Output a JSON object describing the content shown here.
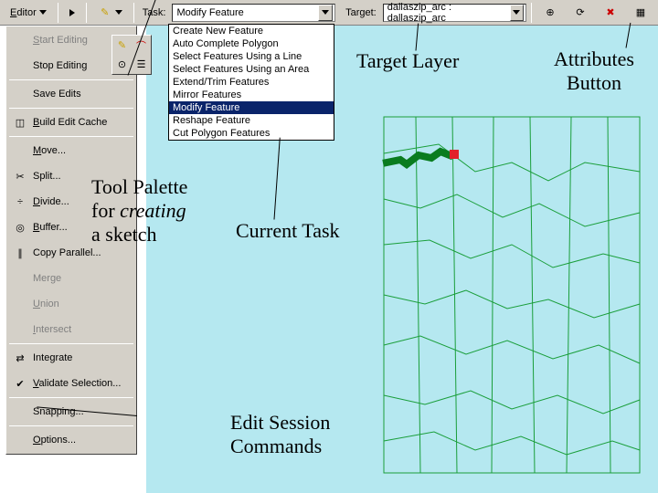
{
  "toolbar": {
    "editor_label": "Editor",
    "task_label": "Task:",
    "task_value": "Modify Feature",
    "target_label": "Target:",
    "target_value": "dallaszip_arc : dallaszip_arc"
  },
  "task_options": [
    "Create New Feature",
    "Auto Complete Polygon",
    "Select Features Using a Line",
    "Select Features Using an Area",
    "Extend/Trim Features",
    "Mirror Features",
    "Modify Feature",
    "Reshape Feature",
    "Cut Polygon Features"
  ],
  "task_selected_index": 6,
  "editor_menu": [
    {
      "label": "Start Editing",
      "disabled": true,
      "icon": "",
      "u": true
    },
    {
      "label": "Stop Editing",
      "disabled": false,
      "icon": "",
      "u": false
    },
    {
      "sep": true
    },
    {
      "label": "Save Edits",
      "disabled": false,
      "icon": "",
      "u": false
    },
    {
      "sep": true
    },
    {
      "label": "Build Edit Cache",
      "disabled": false,
      "icon": "cache",
      "u": true
    },
    {
      "sep": true
    },
    {
      "label": "Move...",
      "disabled": false,
      "icon": "",
      "u": true
    },
    {
      "label": "Split...",
      "disabled": false,
      "icon": "split",
      "u": false
    },
    {
      "label": "Divide...",
      "disabled": false,
      "icon": "divide",
      "u": true
    },
    {
      "label": "Buffer...",
      "disabled": false,
      "icon": "buffer",
      "u": true
    },
    {
      "label": "Copy Parallel...",
      "disabled": false,
      "icon": "parallel",
      "u": false
    },
    {
      "label": "Merge",
      "disabled": true,
      "icon": "",
      "u": false
    },
    {
      "label": "Union",
      "disabled": true,
      "icon": "",
      "u": true
    },
    {
      "label": "Intersect",
      "disabled": true,
      "icon": "",
      "u": true
    },
    {
      "sep": true
    },
    {
      "label": "Integrate",
      "disabled": false,
      "icon": "integrate",
      "u": false
    },
    {
      "label": "Validate Selection...",
      "disabled": false,
      "icon": "validate",
      "u": true
    },
    {
      "sep": true
    },
    {
      "label": "Snapping...",
      "disabled": false,
      "icon": "",
      "u": false
    },
    {
      "sep": true
    },
    {
      "label": "Options...",
      "disabled": false,
      "icon": "",
      "u": true
    }
  ],
  "tool_palette": {
    "tools": [
      "pencil",
      "curve",
      "trace",
      "replace"
    ]
  },
  "icons": {
    "play": "▶",
    "pencil": "✎",
    "curve": "～",
    "trace": "⊙",
    "replace": "⟳",
    "cache": "◫",
    "split": "✂",
    "divide": "÷",
    "buffer": "◎",
    "parallel": "∥",
    "integrate": "⇄",
    "validate": "✔",
    "crosshair": "⊕",
    "rotate": "⟳",
    "noedit": "✖",
    "table": "▦"
  },
  "annotations": {
    "tool_palette_l1": "Tool Palette",
    "tool_palette_l2_a": "for ",
    "tool_palette_l2_b": "creating",
    "tool_palette_l3": "a sketch",
    "current_task": "Current Task",
    "edit_session_l1": "Edit Session",
    "edit_session_l2": "Commands",
    "target_layer": "Target Layer",
    "attributes_l1": "Attributes",
    "attributes_l2": "Button"
  }
}
